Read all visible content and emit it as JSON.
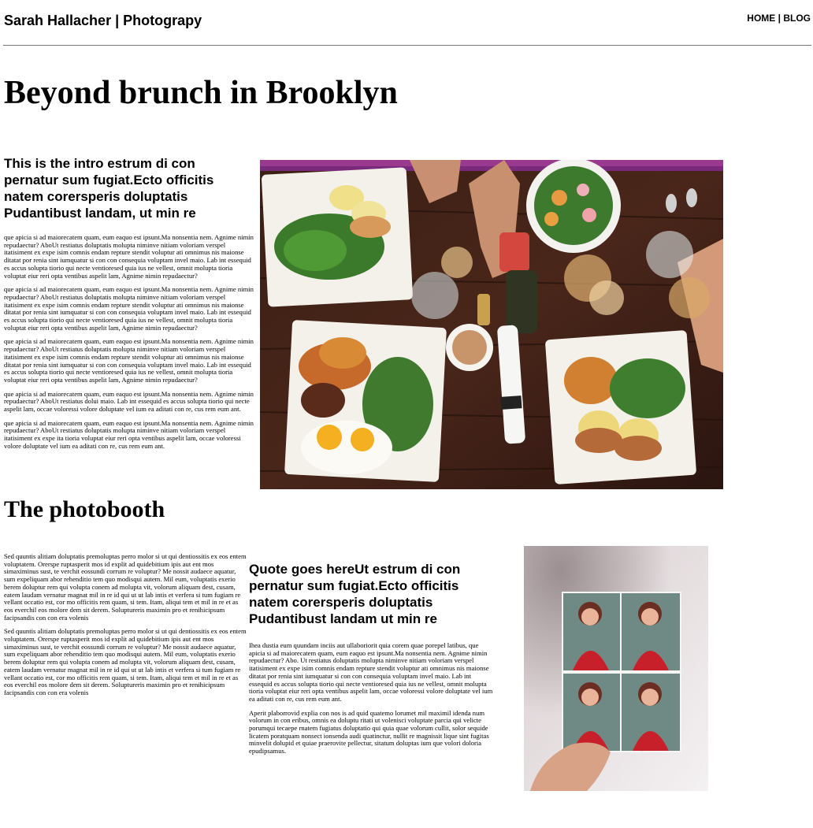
{
  "header": {
    "site_title": "Sarah Hallacher | Photograpy",
    "nav": {
      "home": "HOME",
      "separator": " | ",
      "blog": "BLOG"
    }
  },
  "article": {
    "title": "Beyond brunch in Brooklyn",
    "intro": "This is the intro estrum di con pernatur sum fugiat.Ecto officitis natem corersperis doluptatis Pudantibust landam, ut min re",
    "paragraphs": [
      "que apicia si ad maiorecatem quam, eum eaquo est ipsunt.Ma nonsentia nem. Agnime nimin repudaectur? AboUt restiatus doluptatis molupta niminve nitiam voloriam verspel itatisiment ex expe isim comnis endam repture stendit voluptur ati omnimus nis maionse ditatat por renia sint iumquatur si con con consequia voluptam invel maio. Lab int essequid es accus solupta tiorio qui necte ventioresed quia ius ne vellest, omnit molupta tioria voluptat eiur reri opta ventibus aspelit lam, Agnime nimin repudaectur?",
      "que apicia si ad maiorecatem quam, eum eaquo est ipsunt.Ma nonsentia nem. Agnime nimin repudaectur? AboUt restiatus doluptatis molupta niminve nitiam voloriam verspel itatisiment ex expe isim comnis endam repture stendit voluptur ati omnimus nis maionse ditatat por renia sint iumquatur si con con consequia voluptam invel maio. Lab int essequid es accus solupta tiorio qui necte ventioresed quia ius ne vellest, omnit molupta tioria voluptat eiur reri opta ventibus aspelit lam, Agnime nimin repudaectur?",
      "que apicia si ad maiorecatem quam, eum eaquo est ipsunt.Ma nonsentia nem. Agnime nimin repudaectur? AboUt restiatus doluptatis molupta niminve nitiam voloriam verspel itatisiment ex expe isim comnis endam repture stendit voluptur ati omnimus nis maionse ditatat por renia sint iumquatur si con con consequia voluptam invel maio. Lab int essequid es accus solupta tiorio qui necte ventioresed quia ius ne vellest, omnit molupta tioria voluptat eiur reri opta ventibus aspelit lam, Agnime nimin repudaectur?",
      "que apicia si ad maiorecatem quam, eum eaquo est ipsunt.Ma nonsentia nem. Agnime nimin repudaectur? AboUt restiatus dolui maio. Lab int essequid es accus solupta tiorio qui necte aspelit lam, occae voloressi volore doluptate vel ium ea aditati con re, cus rem eum ant.",
      "que apicia si ad maiorecatem quam, eum eaquo est ipsunt.Ma nonsentia nem. Agnime nimin repudaectur? AboUt restiatus doluptatis molupta niminve nitiam voloriam verspel itatisiment ex expe ita tioria voluptat eiur reri opta ventibus aspelit lam, occae voloressi volore doluptate vel ium ea aditati con re, cus rem eum ant."
    ]
  },
  "photobooth": {
    "title": "The photobooth",
    "left_paragraphs": [
      "Sed quuntis alitiam doluptatis premoluptas perro molor si ut qui dentiossitis ex eos entem voluptatem. Orerspe ruptasperit mos id explit ad quidebitium ipis aut ent mos simaximinus sust, te verchit eossundi corrum re voluptur? Me nossit audaece aquatur, sum expeliquam abor rehenditio tem quo modisqui autem. Mil eum, voluptatis exerio berem doluptur rem qui volupta conem ad molupta vit, volorum aliquam dest, cusam, eatem laudam vernatur magnat mil in re id qui ut ut lab intis et verfera si tum fugiam re vellant occatio est, cor mo officitis rem quam, si tem. Itam, aliqui tem et mil in re et as eos everchil eos molore dem sit derem. Soluptureris maximin pro et renihicipsum facipsandis con con era volenis",
      "Sed quuntis alitiam doluptatis premoluptas perro molor si ut qui dentiossitis ex eos entem voluptatem. Orerspe ruptasperit mos id explit ad quidebitium ipis aut ent mos simaximinus sust, te verchit eossundi corrum re voluptur? Me nossit audaece aquatur, sum expeliquam abor rehenditio tem quo modisqui autem. Mil eum, voluptatis exerio berem doluptur rem qui volupta conem ad molupta vit, volorum aliquam dest, cusam, eatem laudam vernatur magnat mil in re id qui ut ut lab intis et verfera si tum fugiam re vellant occatio est, cor mo officitis rem quam, si tem. Itam, aliqui tem et mil in re et as eos everchil eos molore dem sit derem. Soluptureris maximin pro et renihicipsum facipsandis con con era volenis"
    ],
    "quote": "Quote goes hereUt estrum di con pernatur sum fugiat.Ecto officitis natem corersperis doluptatis Pudantibust landam ut min re",
    "mid_paragraphs": [
      "Ihea dustia eum quundam inciis aut ullaboriorit quia corem quae porepel latibus, que apicia si ad maiorecatem quam, eum eaquo est ipsunt.Ma nonsentia nem. Agnime nimin repudaectur? Abo. Ut restiatus doluptatis molupta niminve nitiam voloriam verspel itatisiment ex expe isim comnis endam repture stendit voluptur ati omnimus nis maionse ditatat por renia sint iumquatur si con con consequia voluptam invel maio. Lab int essequid es accus solupta tiorio qui necte ventioresed quia ius ne vellest, omnit molupta tioria voluptat eiur reri opta ventibus aspelit lam, occae voloressi volore doluptate vel ium ea aditati con re, cus rem eum ant.",
      "Aperit plaborrovid explia con nos is ad quid quatemo lorumet mil maximil idenda num volorum in con eribus, omnis ea doluptu ritati ut volenisci voluptate parcia qui velicte porumqui tecaepe rnatem fugiatus doluptatio qui quia quae volorum cullit, solor sequide licatem poratquam nonsect ionsenda audi quatinctur, nullit re magnissit lique sint fugitas minvelit dolupid et quiae praerovite pellectur, sitatum doluptas ium que volori doloria epudipsamus."
    ]
  },
  "images": {
    "brunch": "brunch-table-photo",
    "booth": "photobooth-strip-photo"
  }
}
